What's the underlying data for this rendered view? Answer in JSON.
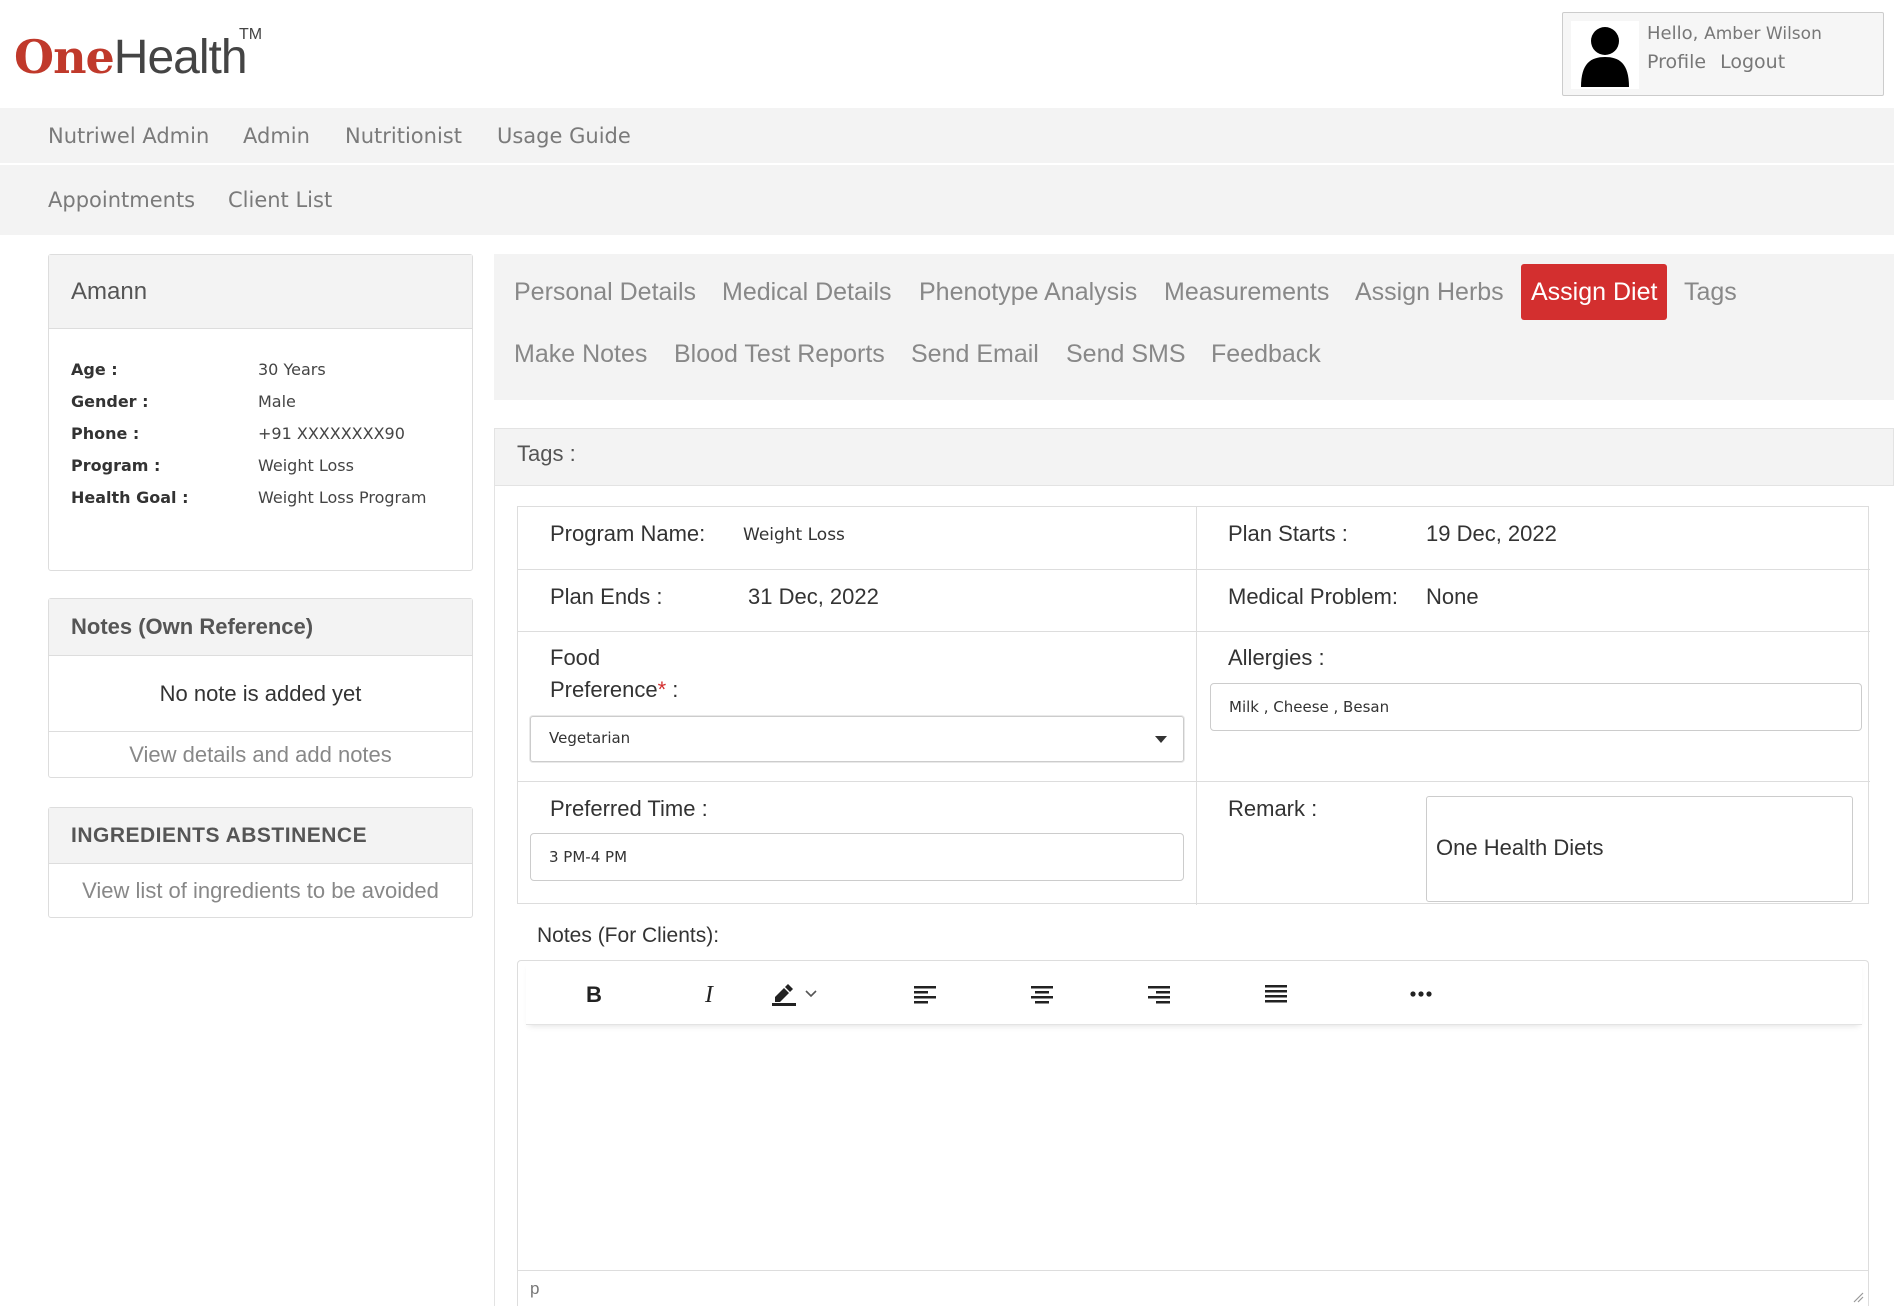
{
  "brand": {
    "one": "One",
    "health": "Health",
    "tm": "TM",
    "colors": {
      "accent": "#d32f2f",
      "logo_red": "#c0392b"
    }
  },
  "user": {
    "hello": "Hello,",
    "name": "Amber Wilson",
    "profile": "Profile",
    "logout": "Logout"
  },
  "nav": {
    "row1": [
      "Nutriwel Admin",
      "Admin",
      "Nutritionist",
      "Usage Guide"
    ],
    "row2": [
      "Appointments",
      "Client List"
    ]
  },
  "client": {
    "name": "Amann",
    "fields": [
      {
        "label": "Age :",
        "value": "30 Years"
      },
      {
        "label": "Gender :",
        "value": "Male"
      },
      {
        "label": "Phone :",
        "value": "+91 XXXXXXXX90"
      },
      {
        "label": "Program :",
        "value": "Weight Loss"
      },
      {
        "label": "Health Goal :",
        "value": "Weight Loss Program"
      }
    ]
  },
  "notes_panel": {
    "title": "Notes (Own Reference)",
    "empty": "No note is added yet",
    "link": "View details and add notes"
  },
  "ingredients_panel": {
    "title": "INGREDIENTS ABSTINENCE",
    "link": "View list of ingredients to be avoided"
  },
  "tabs": {
    "row1": [
      "Personal Details",
      "Medical Details",
      "Phenotype Analysis",
      "Measurements",
      "Assign Herbs",
      "Assign Diet",
      "Tags"
    ],
    "row2": [
      "Make Notes",
      "Blood Test Reports",
      "Send Email",
      "Send SMS",
      "Feedback"
    ],
    "active": "Assign Diet"
  },
  "section": {
    "title": "Tags :"
  },
  "form": {
    "program_name_label": "Program Name:",
    "program_name": "Weight Loss",
    "plan_starts_label": "Plan Starts :",
    "plan_starts": "19 Dec, 2022",
    "plan_ends_label": "Plan Ends :",
    "plan_ends": "31 Dec, 2022",
    "medical_problem_label": "Medical Problem:",
    "medical_problem": "None",
    "food_pref_label_1": "Food",
    "food_pref_label_2": "Preference",
    "required_mark": "*",
    "colon": " :",
    "food_pref_value": "Vegetarian",
    "allergies_label": "Allergies :",
    "allergies_value": "Milk , Cheese , Besan",
    "preferred_time_label": "Preferred Time :",
    "preferred_time_value": "3 PM-4 PM",
    "remark_label": "Remark :",
    "remark_value": "One Health Diets",
    "notes_label": "Notes (For Clients):"
  },
  "editor": {
    "toolbar": [
      "bold-icon",
      "italic-icon",
      "highlight-icon",
      "align-left-icon",
      "align-center-icon",
      "align-right-icon",
      "align-justify-icon",
      "more-icon"
    ],
    "status": "p"
  }
}
